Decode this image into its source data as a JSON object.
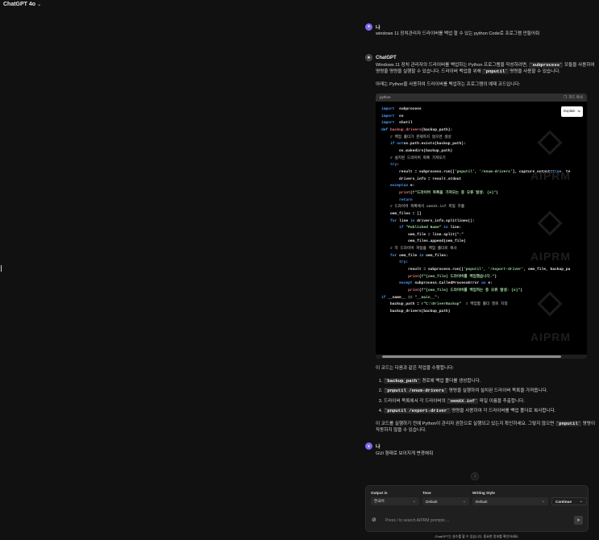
{
  "topbar": {
    "model_name": "ChatGPT 4o"
  },
  "user_message_1": {
    "author": "나",
    "text": "windows 11 장치관리자 드라이버를 백업 할 수 있는 python Code로 프로그램 만들어줘"
  },
  "assistant": {
    "author": "ChatGPT",
    "intro_a": "Windows 11 장치 관리자의 드라이버를 백업하는 Python 프로그램을 작성하려면, ",
    "intro_code1": "`subprocess`",
    "intro_b": " 모듈을 사용하여 명령줄 명령을 실행할 수 있습니다. 드라이버 백업을 위해 ",
    "intro_code2": "`pnputil`",
    "intro_c": " 명령을 사용할 수 있습니다.",
    "lead": "아래는 Python을 사용하여 드라이버를 백업하는 프로그램의 예제 코드입니다:",
    "code_lang": "python",
    "copy_label": "코드 복사",
    "explain_label": "Explain",
    "summary_title": "이 코드는 다음과 같은 작업을 수행합니다:",
    "steps": [
      {
        "code": "`backup_path`",
        "text": " 경로에 백업 폴더를 생성합니다."
      },
      {
        "code": "`pnputil /enum-drivers`",
        "text": " 명령을 실행하여 설치된 드라이버 목록을 가져옵니다."
      },
      {
        "code": "",
        "text": "드라이버 목록에서 각 드라이버의 ",
        "code2": "`oemXX.inf`",
        "text2": " 파일 이름을 추출합니다."
      },
      {
        "code": "`pnputil /export-driver`",
        "text": " 명령을 사용하여 각 드라이버를 백업 폴더로 복사합니다."
      }
    ],
    "note_a": "이 코드를 실행하기 전에 Python이 관리자 권한으로 실행되고 있는지 확인하세요. 그렇지 않으면 ",
    "note_code": "`pnputil`",
    "note_b": " 명령이 작동하지 않을 수 있습니다."
  },
  "code_lines": [
    [
      [
        "kw",
        "import"
      ],
      [
        "",
        "  subprocess"
      ]
    ],
    [
      [
        "kw",
        "import"
      ],
      [
        "",
        "  os"
      ]
    ],
    [
      [
        "kw",
        "import"
      ],
      [
        "",
        "  shutil"
      ]
    ],
    [
      [
        "",
        ""
      ]
    ],
    [
      [
        "kw",
        "def"
      ],
      [
        "",
        " "
      ],
      [
        "fn",
        "backup_drivers"
      ],
      [
        "",
        "(backup_path):"
      ]
    ],
    [
      [
        "",
        "    "
      ],
      [
        "cm",
        "# 백업 폴더가 존재하지 않으면 생성"
      ]
    ],
    [
      [
        "",
        "    "
      ],
      [
        "kw",
        "if not"
      ],
      [
        "",
        "",
        " "
      ],
      [
        "",
        "os.path.exists(backup_path):"
      ]
    ],
    [
      [
        "",
        "        os.makedirs(backup_path)"
      ]
    ],
    [
      [
        "",
        ""
      ]
    ],
    [
      [
        "",
        "    "
      ],
      [
        "cm",
        "# 설치된 드라이버 목록 가져오기"
      ]
    ],
    [
      [
        "",
        "    "
      ],
      [
        "kw",
        "try"
      ],
      [
        "",
        ":"
      ]
    ],
    [
      [
        "",
        "        result = subprocess.run(["
      ],
      [
        "str",
        "'pnputil'"
      ],
      [
        "",
        ", "
      ],
      [
        "str",
        "'/enum-drivers'"
      ],
      [
        "",
        "], capture_output="
      ],
      [
        "kw",
        "True"
      ],
      [
        "",
        ", te"
      ]
    ],
    [
      [
        "",
        "        drivers_info = result.stdout"
      ]
    ],
    [
      [
        "",
        "    "
      ],
      [
        "kw",
        "except"
      ],
      [
        "",
        "",
        " subprocess.CalledProcessError "
      ],
      [
        "kw",
        "as"
      ],
      [
        "",
        " e:"
      ]
    ],
    [
      [
        "",
        "        "
      ],
      [
        "fn",
        "print"
      ],
      [
        "",
        "("
      ],
      [
        "str",
        "f\"드라이버 목록을 가져오는 중 오류 발생: {e}\""
      ],
      [
        "",
        ")"
      ]
    ],
    [
      [
        "",
        "        "
      ],
      [
        "kw",
        "return"
      ]
    ],
    [
      [
        "",
        ""
      ]
    ],
    [
      [
        "",
        "    "
      ],
      [
        "cm",
        "# 드라이버 목록에서 oemXX.inf 파일 추출"
      ]
    ],
    [
      [
        "",
        "    oem_files = []"
      ]
    ],
    [
      [
        "",
        "    "
      ],
      [
        "kw",
        "for"
      ],
      [
        "",
        " line "
      ],
      [
        "kw",
        "in"
      ],
      [
        "",
        " drivers_info.splitlines():"
      ]
    ],
    [
      [
        "",
        "        "
      ],
      [
        "kw",
        "if"
      ],
      [
        "",
        " "
      ],
      [
        "str",
        "\"Published Name\""
      ],
      [
        "",
        " "
      ],
      [
        "kw",
        "in"
      ],
      [
        "",
        " line:"
      ]
    ],
    [
      [
        "",
        "            oem_file = line.split("
      ],
      [
        "str",
        "\":\""
      ],
      [
        ")[1].strip()"
      ]
    ],
    [
      [
        "",
        "            oem_files.append(oem_file)"
      ]
    ],
    [
      [
        "",
        ""
      ]
    ],
    [
      [
        "",
        "    "
      ],
      [
        "cm",
        "# 각 드라이버 파일을 백업 폴더로 복사"
      ]
    ],
    [
      [
        "",
        "    "
      ],
      [
        "kw",
        "for"
      ],
      [
        "",
        " oem_file "
      ],
      [
        "kw",
        "in"
      ],
      [
        "",
        " oem_files:"
      ]
    ],
    [
      [
        "",
        "        "
      ],
      [
        "kw",
        "try"
      ],
      [
        "",
        ":"
      ]
    ],
    [
      [
        "",
        "            result = subprocess.run(["
      ],
      [
        "str",
        "'pnputil'"
      ],
      [
        "",
        ", "
      ],
      [
        "str",
        "'/export-driver'"
      ],
      [
        "",
        ", oem_file, backup_pa"
      ]
    ],
    [
      [
        "",
        "            "
      ],
      [
        "fn",
        "print"
      ],
      [
        "",
        "("
      ],
      [
        "str",
        "f\"{oem_file} 드라이버를 백업했습니다.\""
      ],
      [
        "",
        ")"
      ]
    ],
    [
      [
        "",
        "        "
      ],
      [
        "kw",
        "except"
      ],
      [
        "",
        " subprocess.CalledProcessError "
      ],
      [
        "kw",
        "as"
      ],
      [
        "",
        " e:"
      ]
    ],
    [
      [
        "",
        "            "
      ],
      [
        "fn",
        "print"
      ],
      [
        "",
        "("
      ],
      [
        "str",
        "f\"{oem_file} 드라이버를 백업하는 중 오류 발생: {e}\""
      ],
      [
        "",
        ")"
      ]
    ],
    [
      [
        "",
        ""
      ]
    ],
    [
      [
        "kw",
        "if"
      ],
      [
        "",
        " __name__ == "
      ],
      [
        "str",
        "\"__main__\""
      ],
      [
        "",
        ":"
      ]
    ],
    [
      [
        "",
        "    backup_path = "
      ],
      [
        "str",
        "r\"C:\\DriverBackup\""
      ],
      [
        "",
        "  "
      ],
      [
        "cm",
        "# 백업할 폴더 경로 지정"
      ]
    ],
    [
      [
        "",
        "    backup_drivers(backup_path)"
      ]
    ]
  ],
  "user_message_2": {
    "author": "나",
    "text": "GUI 형태로 보이지게 변경해줘"
  },
  "composer": {
    "output_in_label": "Output in",
    "output_in_value": "한국어",
    "tone_label": "Tone",
    "tone_value": "Default",
    "style_label": "Writing Style",
    "style_value": "Default",
    "continue_label": "Continue",
    "placeholder": "Press / to search AIPRM prompts ..."
  },
  "footer": {
    "note": "ChatGPT는 실수를 할 수 있습니다. 중요한 정보를 확인하세요."
  },
  "watermark": {
    "text": "AIPRM"
  },
  "colors": {
    "background": "#111111",
    "keyword": "#4da3ff",
    "string": "#9fd89f",
    "function": "#e87f7f",
    "comment": "#8c8c8c"
  }
}
